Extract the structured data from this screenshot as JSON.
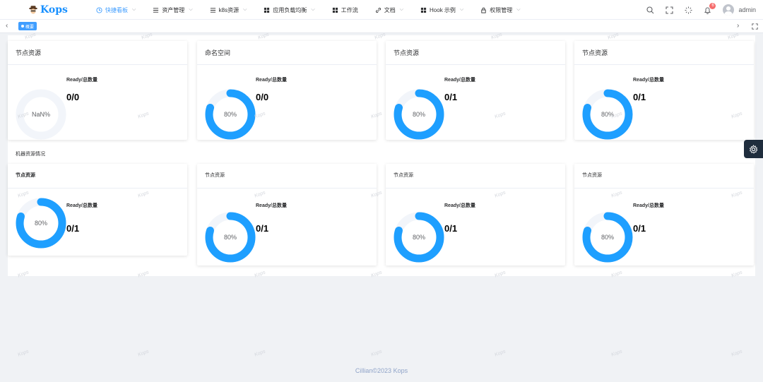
{
  "app": {
    "logo_text": "Kops"
  },
  "nav": [
    {
      "label": "快捷看板",
      "icon": "clock-icon",
      "active": true,
      "has_dropdown": true
    },
    {
      "label": "资产管理",
      "icon": "list-icon",
      "active": false,
      "has_dropdown": true
    },
    {
      "label": "k8s资源",
      "icon": "list-icon",
      "active": false,
      "has_dropdown": true
    },
    {
      "label": "应用负载均衡",
      "icon": "grid-icon",
      "active": false,
      "has_dropdown": true
    },
    {
      "label": "工作流",
      "icon": "grid-icon",
      "active": false,
      "has_dropdown": false
    },
    {
      "label": "文档",
      "icon": "link-icon",
      "active": false,
      "has_dropdown": true
    },
    {
      "label": "Hook 示例",
      "icon": "grid-icon",
      "active": false,
      "has_dropdown": true
    },
    {
      "label": "权限管理",
      "icon": "lock-icon",
      "active": false,
      "has_dropdown": true
    }
  ],
  "header": {
    "notification_count": "6",
    "user_name": "admin"
  },
  "tabs": [
    {
      "label": "概要"
    }
  ],
  "section_label": "机器资源情况",
  "ready_label": "Ready/总数量",
  "row1": [
    {
      "title": "节点资源",
      "percent_label": "NaN%",
      "fill": 0,
      "value": "0/0"
    },
    {
      "title": "命名空间",
      "percent_label": "80%",
      "fill": 0.8,
      "value": "0/0"
    },
    {
      "title": "节点资源",
      "percent_label": "80%",
      "fill": 0.8,
      "value": "0/1"
    },
    {
      "title": "节点资源",
      "percent_label": "80%",
      "fill": 0.8,
      "value": "0/1"
    }
  ],
  "row2": [
    {
      "title": "节点资源",
      "percent_label": "80%",
      "fill": 0.8,
      "value": "0/1"
    },
    {
      "title": "节点资源",
      "percent_label": "80%",
      "fill": 0.8,
      "value": "0/1"
    },
    {
      "title": "节点资源",
      "percent_label": "80%",
      "fill": 0.8,
      "value": "0/1"
    },
    {
      "title": "节点资源",
      "percent_label": "80%",
      "fill": 0.8,
      "value": "0/1"
    }
  ],
  "colors": {
    "accent": "#409eff",
    "donut": "#1e9fff",
    "donut_track": "#f2f5fa"
  },
  "watermark": "Kops",
  "footer": "Cillian©2023 Kops"
}
